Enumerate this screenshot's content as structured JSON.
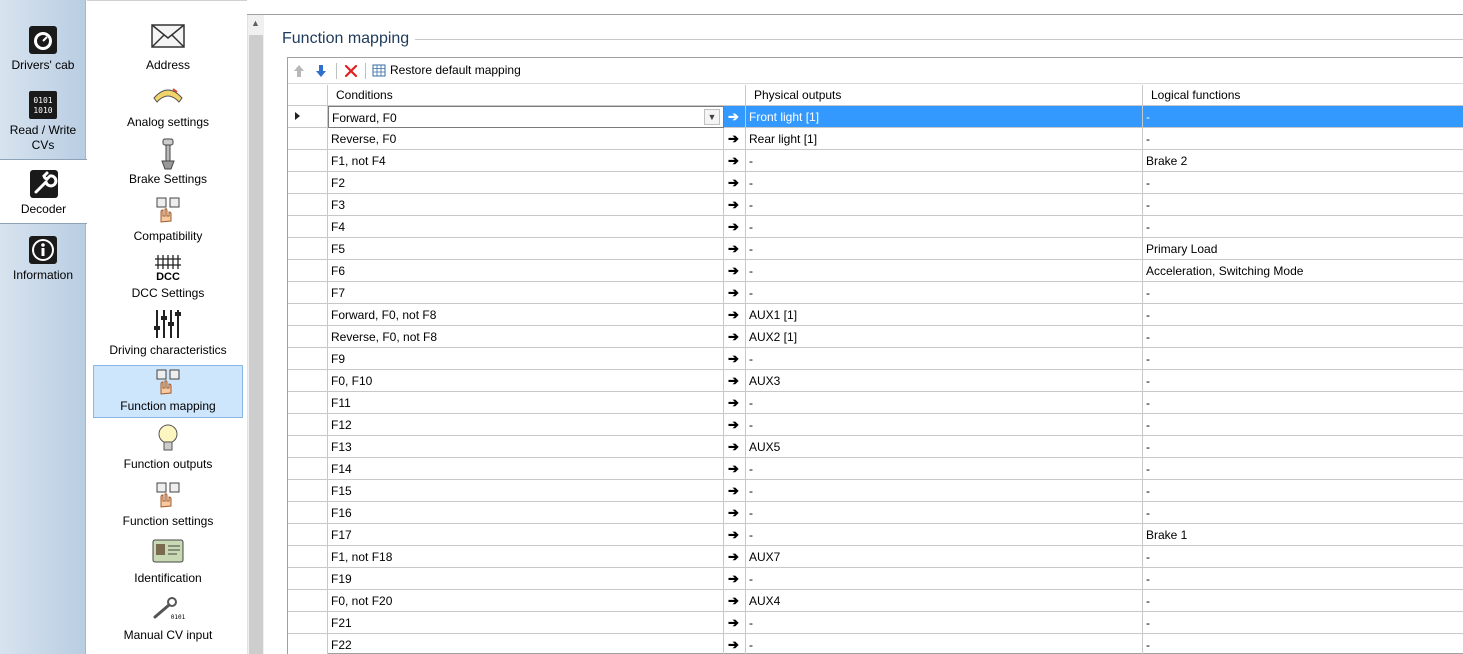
{
  "categories": [
    {
      "label": "Drivers' cab",
      "icon": "speedometer-icon"
    },
    {
      "label": "Read / Write CVs",
      "icon": "binary-chip-icon"
    },
    {
      "label": "Decoder",
      "icon": "wrench-icon",
      "active": true
    },
    {
      "label": "Information",
      "icon": "info-icon"
    }
  ],
  "subnav": [
    {
      "label": "Address",
      "icon": "envelope-icon"
    },
    {
      "label": "Analog settings",
      "icon": "gauge-icon"
    },
    {
      "label": "Brake Settings",
      "icon": "brake-lever-icon"
    },
    {
      "label": "Compatibility",
      "icon": "hand-buttons-icon"
    },
    {
      "label": "DCC Settings",
      "icon": "dcc-icon",
      "icon_text": "DCC"
    },
    {
      "label": "Driving characteristics",
      "icon": "sliders-icon"
    },
    {
      "label": "Function mapping",
      "icon": "hand-buttons-icon",
      "active": true
    },
    {
      "label": "Function outputs",
      "icon": "lightbulb-icon"
    },
    {
      "label": "Function settings",
      "icon": "hand-buttons-icon"
    },
    {
      "label": "Identification",
      "icon": "id-card-icon"
    },
    {
      "label": "Manual CV input",
      "icon": "wrench-cv-icon"
    }
  ],
  "section": {
    "title": "Function mapping"
  },
  "toolbar": {
    "restore_label": "Restore default mapping"
  },
  "columns": {
    "conditions": "Conditions",
    "outputs": "Physical outputs",
    "logical": "Logical functions"
  },
  "rows": [
    {
      "cond": "Forward, F0",
      "out": "Front light [1]",
      "log": "-",
      "selected": true
    },
    {
      "cond": "Reverse, F0",
      "out": "Rear light [1]",
      "log": "-"
    },
    {
      "cond": "F1, not F4",
      "out": "-",
      "log": "Brake 2"
    },
    {
      "cond": "F2",
      "out": "-",
      "log": "-"
    },
    {
      "cond": "F3",
      "out": "-",
      "log": "-"
    },
    {
      "cond": "F4",
      "out": "-",
      "log": "-"
    },
    {
      "cond": "F5",
      "out": "-",
      "log": "Primary Load"
    },
    {
      "cond": "F6",
      "out": "-",
      "log": "Acceleration, Switching Mode"
    },
    {
      "cond": "F7",
      "out": "-",
      "log": "-"
    },
    {
      "cond": "Forward, F0, not F8",
      "out": "AUX1 [1]",
      "log": "-"
    },
    {
      "cond": "Reverse, F0, not F8",
      "out": "AUX2 [1]",
      "log": "-"
    },
    {
      "cond": "F9",
      "out": "-",
      "log": "-"
    },
    {
      "cond": "F0, F10",
      "out": "AUX3",
      "log": "-"
    },
    {
      "cond": "F11",
      "out": "-",
      "log": "-"
    },
    {
      "cond": "F12",
      "out": "-",
      "log": "-"
    },
    {
      "cond": "F13",
      "out": "AUX5",
      "log": "-"
    },
    {
      "cond": "F14",
      "out": "-",
      "log": "-"
    },
    {
      "cond": "F15",
      "out": "-",
      "log": "-"
    },
    {
      "cond": "F16",
      "out": "-",
      "log": "-"
    },
    {
      "cond": "F17",
      "out": "-",
      "log": "Brake 1"
    },
    {
      "cond": "F1, not F18",
      "out": "AUX7",
      "log": "-"
    },
    {
      "cond": "F19",
      "out": "-",
      "log": "-"
    },
    {
      "cond": "F0, not F20",
      "out": "AUX4",
      "log": "-"
    },
    {
      "cond": "F21",
      "out": "-",
      "log": "-"
    },
    {
      "cond": "F22",
      "out": "-",
      "log": "-"
    }
  ],
  "colors": {
    "selection": "#3399ff",
    "active_nav": "#cde6fb",
    "title": "#1e3a5c"
  }
}
